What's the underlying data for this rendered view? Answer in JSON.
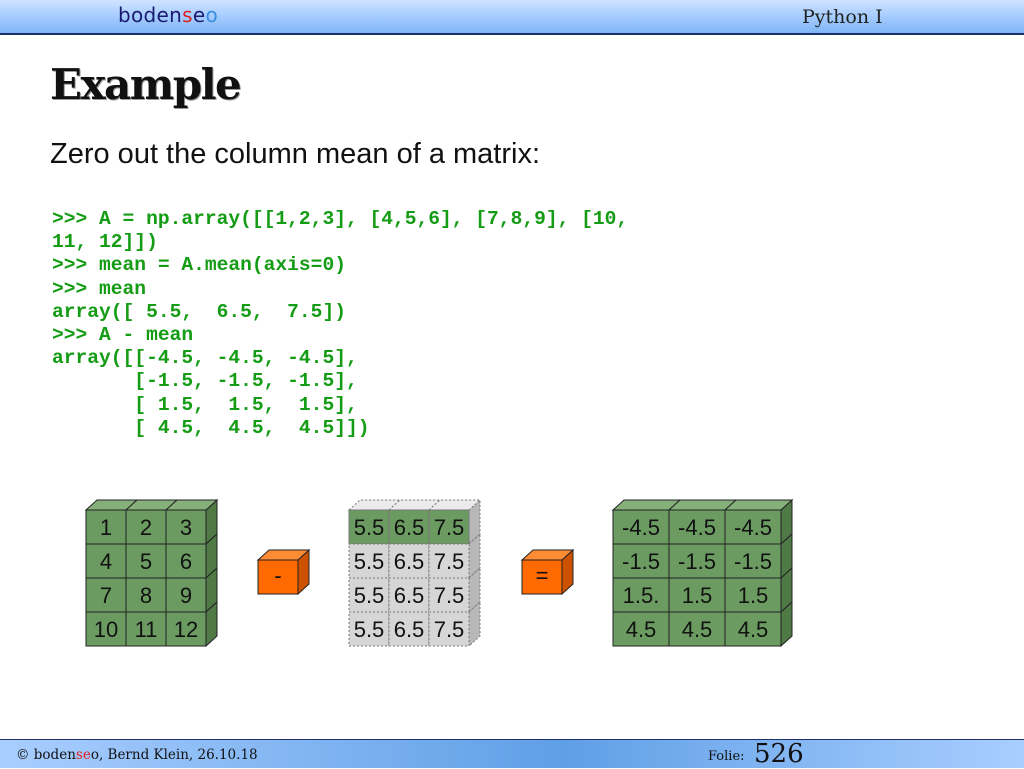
{
  "header": {
    "brand_pre": "boden",
    "brand_red": "s",
    "brand_mid": "e",
    "brand_blue": "o",
    "course": "Python I"
  },
  "slide": {
    "title": "Example",
    "subtitle": "Zero out the column mean of a matrix:"
  },
  "code_lines": [
    ">>> A = np.array([[1,2,3], [4,5,6], [7,8,9], [10,",
    "11, 12]])",
    ">>> mean = A.mean(axis=0)",
    ">>> mean",
    "array([ 5.5,  6.5,  7.5])",
    ">>> A - mean",
    "array([[-4.5, -4.5, -4.5],",
    "       [-1.5, -1.5, -1.5],",
    "       [ 1.5,  1.5,  1.5],",
    "       [ 4.5,  4.5,  4.5]])"
  ],
  "diagram": {
    "matrix_a": [
      [
        "1",
        "2",
        "3"
      ],
      [
        "4",
        "5",
        "6"
      ],
      [
        "7",
        "8",
        "9"
      ],
      [
        "10",
        "11",
        "12"
      ]
    ],
    "matrix_mean": [
      [
        "5.5",
        "6.5",
        "7.5"
      ],
      [
        "5.5",
        "6.5",
        "7.5"
      ],
      [
        "5.5",
        "6.5",
        "7.5"
      ],
      [
        "5.5",
        "6.5",
        "7.5"
      ]
    ],
    "matrix_result": [
      [
        "-4.5",
        "-4.5",
        "-4.5"
      ],
      [
        "-1.5",
        "-1.5",
        "-1.5"
      ],
      [
        "1.5.",
        "1.5",
        "1.5"
      ],
      [
        "4.5",
        "4.5",
        "4.5"
      ]
    ],
    "minus_op": "-",
    "equals_op": "=",
    "colors": {
      "green_face": "#6b9b61",
      "green_side": "#4f7a46",
      "green_top": "#85b079",
      "gray_face": "#d6d6d6",
      "gray_side": "#b8b8b8",
      "gray_top": "#ebebeb",
      "orange_face": "#ff6a00",
      "orange_side": "#cc5200",
      "orange_top": "#ff8c33"
    }
  },
  "footer": {
    "copyright": "© boden",
    "copyright_red": "se",
    "copyright_rest": "o, Bernd Klein, 26.10.18",
    "folie_label": "Folie:",
    "slide_number": "526"
  }
}
